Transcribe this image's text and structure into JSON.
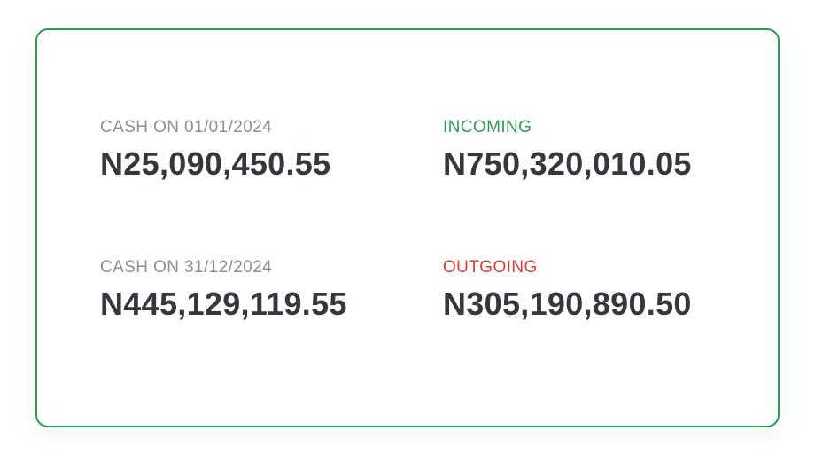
{
  "summary": {
    "opening": {
      "label": "CASH ON 01/01/2024",
      "value": "N25,090,450.55"
    },
    "incoming": {
      "label": "INCOMING",
      "value": "N750,320,010.05"
    },
    "closing": {
      "label": "CASH ON 31/12/2024",
      "value": "N445,129,119.55"
    },
    "outgoing": {
      "label": "OUTGOING",
      "value": "N305,190,890.50"
    }
  },
  "colors": {
    "card_border": "#2e9a55",
    "label_neutral": "#8a8f95",
    "label_incoming": "#2e9a55",
    "label_outgoing": "#e53935",
    "value_text": "#34383d"
  }
}
